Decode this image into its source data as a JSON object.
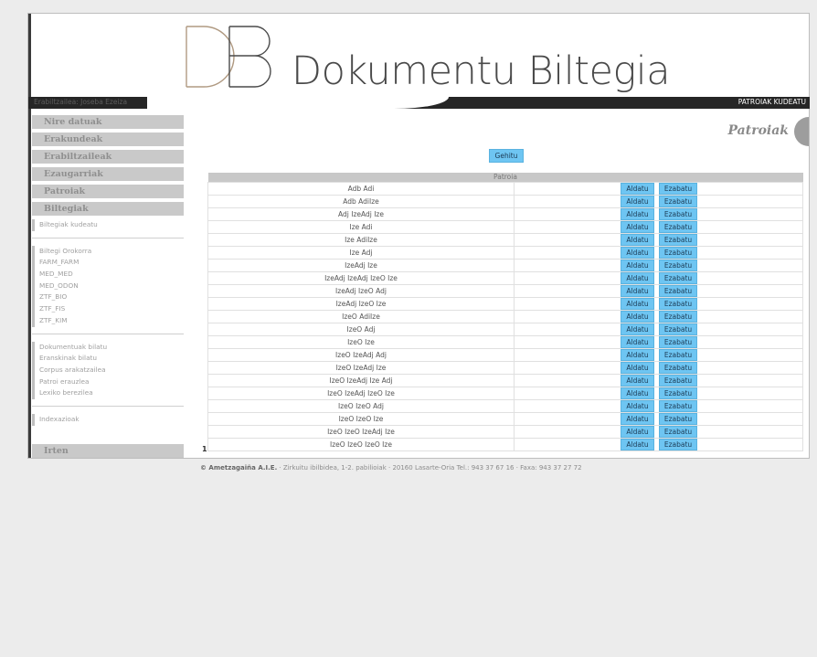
{
  "header": {
    "logo_text": "Dokumentu Biltegia",
    "user_label": "Erabiltzailea: Joseba Ezeiza",
    "section_label": "PATROIAK KUDEATU"
  },
  "sidebar": {
    "menu": [
      {
        "label": "Nire datuak"
      },
      {
        "label": "Erakundeak"
      },
      {
        "label": "Erabiltzaileak"
      },
      {
        "label": "Ezaugarriak"
      },
      {
        "label": "Patroiak"
      },
      {
        "label": "Biltegiak"
      }
    ],
    "manage_label": "Biltegiak kudeatu",
    "repositories": [
      "Biltegi Orokorra",
      "FARM_FARM",
      "MED_MED",
      "MED_ODON",
      "ZTF_BIO",
      "ZTF_FIS",
      "ZTF_KIM"
    ],
    "tools": [
      "Dokumentuak bilatu",
      "Eranskinak bilatu",
      "Corpus arakatzailea",
      "Patroi erauzlea",
      "Lexiko berezilea"
    ],
    "indexing": "Indexazioak",
    "logout": "Irten"
  },
  "main": {
    "title": "Patroiak",
    "add_label": "Gehitu",
    "table_header": "Patroia",
    "edit_label": "Aldatu",
    "delete_label": "Ezabatu",
    "rows": [
      "Adb Adi",
      "Adb AdiIze",
      "Adj IzeAdj Ize",
      "Ize Adi",
      "Ize AdiIze",
      "Ize Adj",
      "IzeAdj Ize",
      "IzeAdj IzeAdj IzeO Ize",
      "IzeAdj IzeO Adj",
      "IzeAdj IzeO Ize",
      "IzeO AdiIze",
      "IzeO Adj",
      "IzeO Ize",
      "IzeO IzeAdj Adj",
      "IzeO IzeAdj Ize",
      "IzeO IzeAdj Ize Adj",
      "IzeO IzeAdj IzeO Ize",
      "IzeO IzeO Adj",
      "IzeO IzeO Ize",
      "IzeO IzeO IzeAdj Ize",
      "IzeO IzeO IzeO Ize"
    ],
    "page": "1"
  },
  "footer": {
    "company": "© Ametzagaiña A.I.E.",
    "address": " · Zirkuitu ibilbidea, 1-2. pabilioiak · 20160 Lasarte-Oria Tel.: 943 37 67 16 · Faxa: 943 37 27 72"
  },
  "colors": {
    "button_blue": "#6ec5f2",
    "header_bar": "#262626",
    "menu_gray": "#c9c9c9"
  }
}
